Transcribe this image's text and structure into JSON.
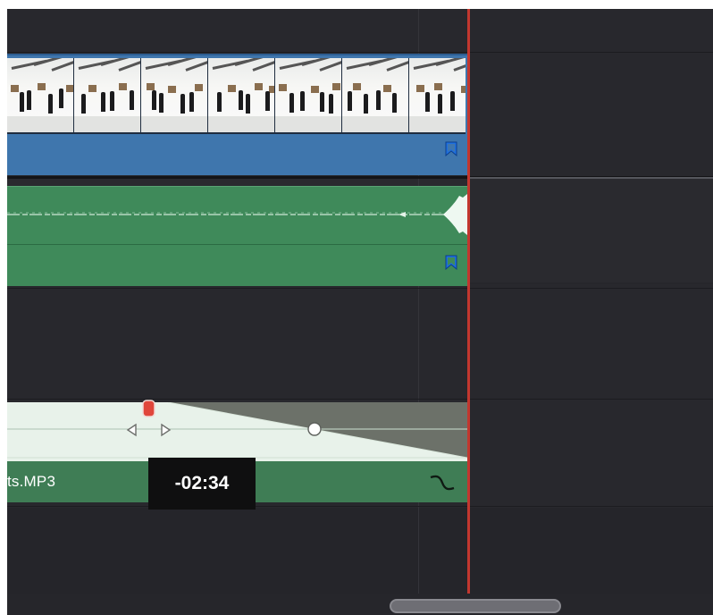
{
  "timeline": {
    "video_clip": {
      "thumbnail_count": 7,
      "has_marker": true,
      "color": "#3f76ad"
    },
    "audio_clip": {
      "has_marker": true,
      "color": "#3f8a5a"
    },
    "fade_clip": {
      "name": "ts.MP3",
      "fade_tooltip": "-02:34",
      "fade_icon": "fade-curve-icon",
      "color": "#3f7d55"
    },
    "playhead_color": "#c2372f",
    "marker_color": "#1e6fe0"
  }
}
